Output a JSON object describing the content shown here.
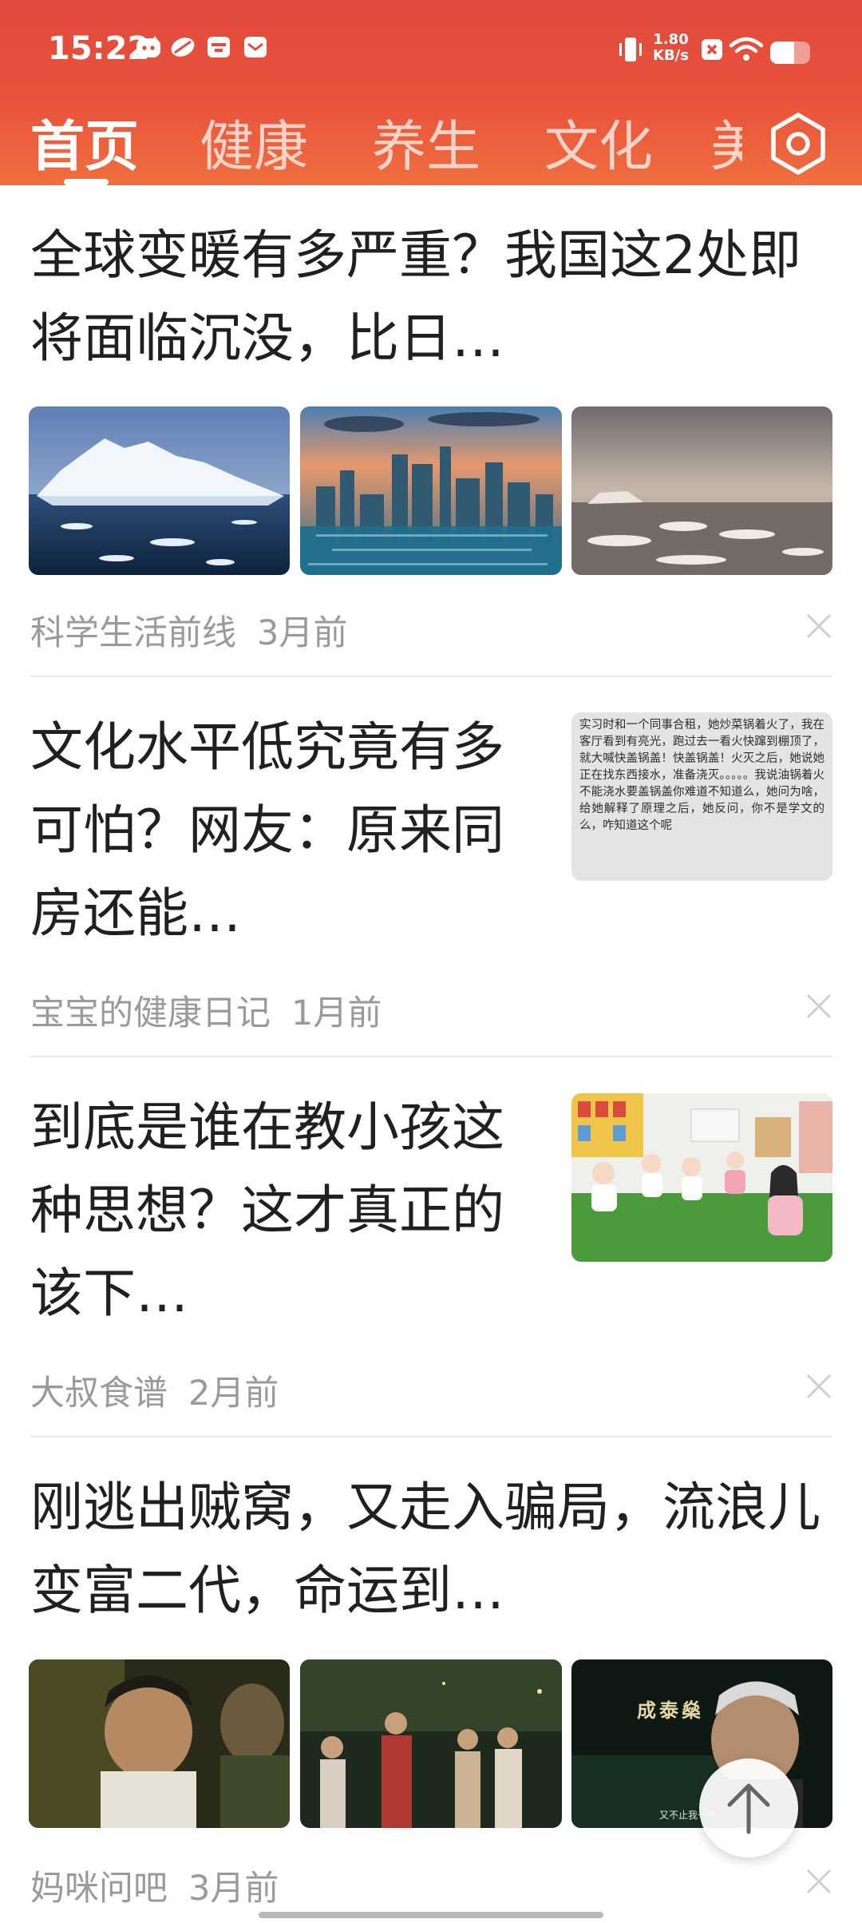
{
  "status_bar": {
    "time": "15:22",
    "net_speed_value": "1.80",
    "net_speed_unit": "KB/s",
    "battery_level": 0.6,
    "icons": [
      "cat-icon",
      "leaf-icon",
      "calendar-icon",
      "envelope-icon",
      "vibrate-icon",
      "no-sim-icon",
      "wifi-icon",
      "battery-icon"
    ]
  },
  "tabs": [
    "首页",
    "健康",
    "养生",
    "文化",
    "美"
  ],
  "active_tab": 0,
  "accent_color": "#e8533b",
  "articles": [
    {
      "title": "全球变暖有多严重？我国这2处即将面临沉没，比日…",
      "source": "科学生活前线",
      "time": "3月前",
      "images": [
        "iceberg-image",
        "flooded-city-image",
        "melting-ice-image"
      ]
    },
    {
      "title": "文化水平低究竟有多可怕？网友：原来同房还能…",
      "source": "宝宝的健康日记",
      "time": "1月前",
      "image_text": "实习时和一个同事合租，她炒菜锅着火了，我在客厅看到有亮光，跑过去一看火快蹿到棚顶了，就大喊快盖锅盖！快盖锅盖！火灭之后，她说她正在找东西接水，准备浇灭。。。。。我说油锅着火不能浇水要盖锅盖你难道不知道么，她问为啥，给她解释了原理之后，她反问，你不是学文的么，咋知道这个呢"
    },
    {
      "title": "到底是谁在教小孩这种思想？这才真正的该下…",
      "source": "大叔食谱",
      "time": "2月前",
      "image": "children-classroom-image"
    },
    {
      "title": "刚逃出贼窝，又走入骗局，流浪儿变富二代，命运到…",
      "source": "妈咪问吧",
      "time": "3月前",
      "images": [
        "movie-still-crying",
        "movie-still-night-group",
        "movie-still-car"
      ],
      "caption_name": "成泰燊",
      "caption_sub": "又不止我一个"
    }
  ]
}
